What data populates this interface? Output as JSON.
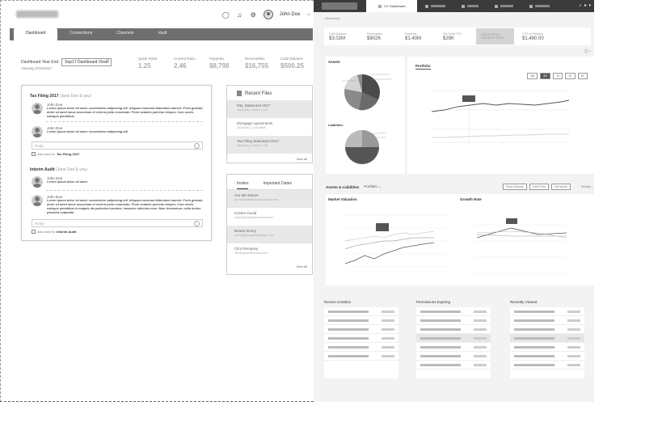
{
  "wireframe": {
    "header": {
      "user_name": "John Doe",
      "caret": "⌵"
    },
    "tabs": [
      "Dashboard",
      "Connections",
      "Channels",
      "Vault"
    ],
    "period": {
      "label": "Dashboard Year End",
      "value": "Sep17 Dashboard View",
      "viewing": "Viewing 2016/2017"
    },
    "stats": [
      {
        "label": "Quick Ratio",
        "value": "1.25"
      },
      {
        "label": "Current Ratio",
        "value": "2.46"
      },
      {
        "label": "Payables",
        "value": "$8,798"
      },
      {
        "label": "Receivables",
        "value": "$16,755"
      },
      {
        "label": "Cash Balance",
        "value": "$500.25"
      }
    ],
    "threads": [
      {
        "title": "Tax Filing 2017",
        "meta": "(Jane Doe & you)",
        "comments": [
          {
            "name": "John Doe",
            "text": "Lorem ipsum dolor sit amet, consectetur adipiscing elit. Aliquam euismod bibendum laoreet. Proin gravida dolor sit amet lacus accumsan et viverra justo commodo. Proin sodales pulvinar tempor. Cum sociis natoque penatibus."
          },
          {
            "name": "John Doe",
            "text": "Lorem ipsum dolor sit amet, consectetur adipiscing elit."
          }
        ],
        "reply_placeholder": "Reply",
        "also_send_prefix": "Also send to",
        "also_send_target": "Tax Filing 2017"
      },
      {
        "title": "Interim Audit",
        "meta": "(Jane Doe & you)",
        "comments": [
          {
            "name": "John Doe",
            "text": "Lorem ipsum dolor sit amet."
          },
          {
            "name": "John Doe",
            "text": "Lorem ipsum dolor sit amet, consectetur adipiscing elit. Aliquam euismod bibendum laoreet. Proin gravida dolor sit amet lacus accumsan et viverra justo commodo. Proin sodales pulvinar tempor. Cum sociis natoque penatibus et magnis dis parturient montes, nascetur ridiculus mus. Nam fermentum, nulla luctus pharetra vulputate."
          }
        ],
        "reply_placeholder": "Reply",
        "also_send_prefix": "Also send to",
        "also_send_target": "Interim Audit"
      }
    ],
    "recent_files": {
      "title": "Recent Files",
      "items": [
        {
          "title": "P&L Statement 2017",
          "sub": "Jay Bucky | Added | 2.5K"
        },
        {
          "title": "Mortgage Agreements",
          "sub": "Jay Bucky | Consultant"
        },
        {
          "title": "Tax Filing Statement 2017",
          "sub": "Jay Bucky | Added | 2.5K"
        }
      ],
      "view_all": "View all"
    },
    "contacts": {
      "tabs": [
        "Invites",
        "Important Dates"
      ],
      "items": [
        {
          "name": "Joe Mia Moore",
          "email": "joe.moore@relatedaccounting.com"
        },
        {
          "name": "Kristen Gould",
          "email": "kristen@integrityoutbound.com"
        },
        {
          "name": "Briana Scurry",
          "email": "scurry@pesudotrustledger.com"
        },
        {
          "name": "Clint Dempsey",
          "email": "clint@generationcore.com"
        }
      ],
      "view_all": "View all"
    }
  },
  "mockup": {
    "topbar": {
      "active_tab": "CC Dashboard",
      "other_tabs": [
        "",
        "",
        "",
        "",
        ""
      ]
    },
    "breadcrumb": "◂ Dashboard",
    "kpis": [
      {
        "label": "Cash Balance",
        "value": "$3.02M"
      },
      {
        "label": "Receivables",
        "value": "$902K"
      },
      {
        "label": "Payables",
        "value": "$1.40M"
      },
      {
        "label": "Net Profit YTD",
        "value": "$29K"
      },
      {
        "label": "QUICK RATIO / CURRENT RATIO",
        "value": ""
      },
      {
        "label": "YTD vs Previous",
        "value": "$1,480.00"
      }
    ],
    "assets_title": "Assets",
    "liabilities_title": "Liabilities",
    "portfolio_title": "Portfolio",
    "range_buttons": [
      "3M",
      "6M",
      "1Y",
      "3Y",
      "5Y"
    ],
    "assets_liabilities": {
      "title": "Assets & Liabilities",
      "selector": "Portfolio ⌄",
      "controls": [
        "Show Results",
        "Cash Flow",
        "Net Worth"
      ],
      "time": "Monthly ⌄"
    },
    "market_valuation_title": "Market Valuation",
    "growth_title": "Growth Rate",
    "bottom_lists": [
      {
        "title": "Recent Activities",
        "rows": 6
      },
      {
        "title": "Permissions Expiring",
        "rows": 7
      },
      {
        "title": "Recently Viewed",
        "rows": 7
      }
    ],
    "colors": {
      "topbar": "#3b3b3b",
      "card": "#ffffff",
      "bg": "#f3f3f3",
      "accent": "#5a5a5a"
    }
  }
}
